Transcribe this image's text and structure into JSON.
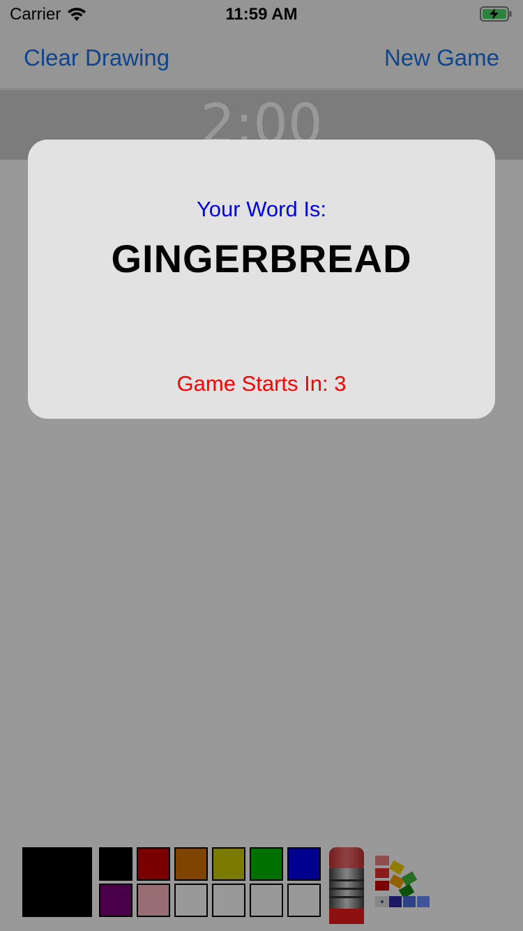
{
  "status_bar": {
    "carrier": "Carrier",
    "time": "11:59 AM",
    "wifi_icon": "wifi-icon",
    "battery_icon": "battery-charging-icon"
  },
  "nav": {
    "left_button": "Clear Drawing",
    "right_button": "New Game",
    "accent_color": "#1a73e8"
  },
  "timer": {
    "value": "2:00"
  },
  "modal": {
    "label": "Your Word Is:",
    "word": "GINGERBREAD",
    "countdown": "Game Starts In: 3",
    "label_color": "#0000e6",
    "countdown_color": "#ff0000"
  },
  "palette": {
    "current_color": "#000000",
    "swatches_row1": [
      "#000000",
      "#cc0000",
      "#d47200",
      "#cccc00",
      "#00bb00",
      "#0000ee"
    ],
    "swatches_row2": [
      "#7a0078",
      "#ffb8be",
      "#ffffff",
      "#ffffff",
      "#ffffff",
      "#ffffff"
    ],
    "eraser_icon": "eraser-icon",
    "color_wheel_icon": "color-picker-icon"
  }
}
